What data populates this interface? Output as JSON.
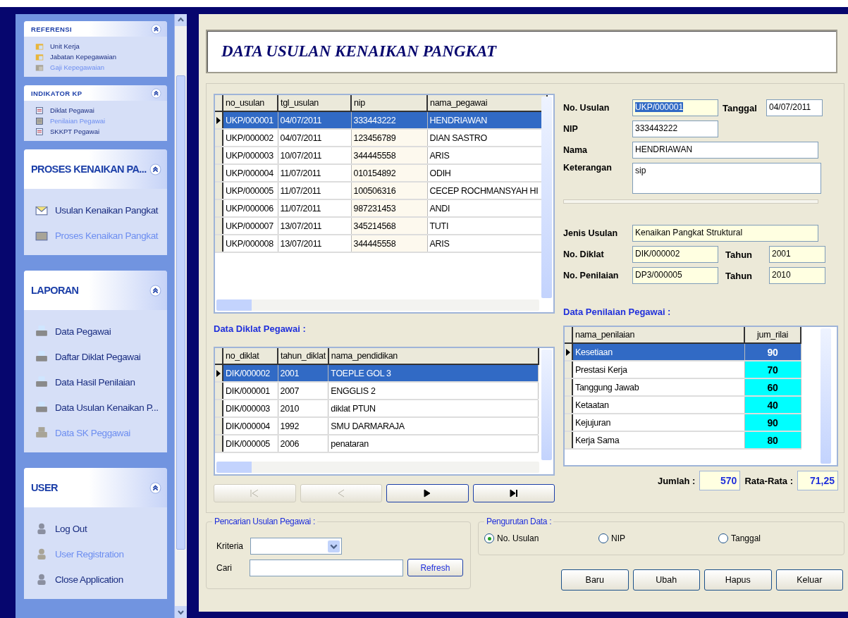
{
  "sidebar": {
    "groups": [
      {
        "title": "REFERENSI",
        "kind": "compact",
        "expanded": true,
        "items": [
          {
            "label": "Unit Kerja",
            "disabled": false
          },
          {
            "label": "Jabatan Kepegawaian",
            "disabled": false
          },
          {
            "label": "Gaji Kepegawaian",
            "disabled": true
          }
        ]
      },
      {
        "title": "INDIKATOR  KP",
        "kind": "compact",
        "expanded": true,
        "items": [
          {
            "label": "Diklat Pegawai",
            "disabled": false
          },
          {
            "label": "Penilaian  Pegawai",
            "disabled": true
          },
          {
            "label": "SKKPT Pegawai",
            "disabled": false
          }
        ]
      },
      {
        "title": "PROSES KENAIKAN PA...",
        "kind": "large",
        "expanded": true,
        "items": [
          {
            "label": "Usulan Kenaikan Pangkat",
            "disabled": false
          },
          {
            "label": "Proses Kenaikan Pangkat",
            "disabled": true
          }
        ]
      },
      {
        "title": "LAPORAN",
        "kind": "large",
        "expanded": true,
        "items": [
          {
            "label": "Data Pegawai",
            "disabled": false
          },
          {
            "label": "Daftar Diklat Pegawai",
            "disabled": false
          },
          {
            "label": "Data Hasil Penilaian",
            "disabled": false
          },
          {
            "label": "Data Usulan Kenaikan P...",
            "disabled": false
          },
          {
            "label": "Data SK Peggawai",
            "disabled": true
          }
        ]
      },
      {
        "title": "USER",
        "kind": "large",
        "expanded": true,
        "items": [
          {
            "label": "Log Out",
            "disabled": false
          },
          {
            "label": "User Registration",
            "disabled": true
          },
          {
            "label": "Close Application",
            "disabled": false
          }
        ]
      }
    ]
  },
  "title": "DATA USULAN KENAIKAN PANGKAT",
  "usulan_table": {
    "columns": [
      "no_usulan",
      "tgl_usulan",
      "nip",
      "nama_pegawai"
    ],
    "rows": [
      {
        "cells": [
          "UKP/000001",
          "04/07/2011",
          "333443222",
          "HENDRIAWAN"
        ],
        "selected": true
      },
      {
        "cells": [
          "UKP/000002",
          "04/07/2011",
          "123456789",
          "DIAN SASTRO"
        ],
        "selected": false
      },
      {
        "cells": [
          "UKP/000003",
          "10/07/2011",
          "344445558",
          "ARIS"
        ],
        "selected": false
      },
      {
        "cells": [
          "UKP/000004",
          "11/07/2011",
          "010154892",
          "ODIH"
        ],
        "selected": false
      },
      {
        "cells": [
          "UKP/000005",
          "11/07/2011",
          "100506316",
          "CECEP ROCHMANSYAH HI"
        ],
        "selected": false
      },
      {
        "cells": [
          "UKP/000006",
          "11/07/2011",
          "987231453",
          "ANDI"
        ],
        "selected": false
      },
      {
        "cells": [
          "UKP/000007",
          "13/07/2011",
          "345214568",
          "TUTI"
        ],
        "selected": false
      },
      {
        "cells": [
          "UKP/000008",
          "13/07/2011",
          "344445558",
          "ARIS"
        ],
        "selected": false
      }
    ]
  },
  "form": {
    "fields": [
      {
        "label": "No. Usulan",
        "value": "UKP/000001",
        "readonly": true,
        "text_selected": true
      },
      {
        "label": "Tanggal",
        "value": "04/07/2011",
        "readonly": false
      },
      {
        "label": "NIP",
        "value": "333443222",
        "readonly": false
      },
      {
        "label": "Nama",
        "value": "HENDRIAWAN",
        "readonly": false
      },
      {
        "label": "Keterangan",
        "value": "sip",
        "readonly": false
      },
      {
        "label": "Jenis Usulan",
        "value": "Kenaikan Pangkat Struktural",
        "readonly": true
      },
      {
        "label": "No. Diklat",
        "value": "DIK/000002",
        "readonly": true
      },
      {
        "label": "Tahun",
        "value": "2001",
        "readonly": true
      },
      {
        "label": "No. Penilaian",
        "value": "DP3/000005",
        "readonly": true
      },
      {
        "label": "Tahun",
        "value": "2010",
        "readonly": true
      }
    ]
  },
  "diklat": {
    "heading": "Data Diklat Pegawai :",
    "columns": [
      "no_diklat",
      "tahun_diklat",
      "nama_pendidikan"
    ],
    "rows": [
      {
        "cells": [
          "DIK/000002",
          "2001",
          "TOEPLE GOL 3"
        ],
        "selected": true
      },
      {
        "cells": [
          "DIK/000001",
          "2007",
          "ENGGLIS 2"
        ],
        "selected": false
      },
      {
        "cells": [
          "DIK/000003",
          "2010",
          "diklat PTUN"
        ],
        "selected": false
      },
      {
        "cells": [
          "DIK/000004",
          "1992",
          "SMU DARMARAJA"
        ],
        "selected": false
      },
      {
        "cells": [
          "DIK/000005",
          "2006",
          "penataran"
        ],
        "selected": false
      }
    ]
  },
  "navigator": [
    {
      "kind": "first",
      "disabled": true
    },
    {
      "kind": "prev",
      "disabled": true
    },
    {
      "kind": "next",
      "disabled": false
    },
    {
      "kind": "last",
      "disabled": false
    }
  ],
  "penilaian": {
    "heading": "Data Penilaian Pegawai :",
    "columns": [
      "nama_penilaian",
      "jum_rilai"
    ],
    "rows": [
      {
        "cells": [
          "Kesetiaan",
          "90"
        ],
        "selected": true
      },
      {
        "cells": [
          "Prestasi Kerja",
          "70"
        ],
        "selected": false
      },
      {
        "cells": [
          "Tanggung Jawab",
          "60"
        ],
        "selected": false
      },
      {
        "cells": [
          "Ketaatan",
          "40"
        ],
        "selected": false
      },
      {
        "cells": [
          "Kejujuran",
          "90"
        ],
        "selected": false
      },
      {
        "cells": [
          "Kerja Sama",
          "80"
        ],
        "selected": false
      }
    ],
    "total_label": "Jumlah :",
    "total": "570",
    "average_label": "Rata-Rata :",
    "average": "71,25"
  },
  "search": {
    "legend": "Pencarian Usulan Pegawai :",
    "criteria_label": "Kriteria",
    "search_label": "Cari",
    "refresh": "Refresh"
  },
  "sort": {
    "legend": "Pengurutan Data :",
    "options": [
      {
        "label": "No. Usulan",
        "selected": true
      },
      {
        "label": "NIP",
        "selected": false
      },
      {
        "label": "Tanggal",
        "selected": false
      }
    ]
  },
  "buttons": [
    "Baru",
    "Ubah",
    "Hapus",
    "Keluar"
  ]
}
